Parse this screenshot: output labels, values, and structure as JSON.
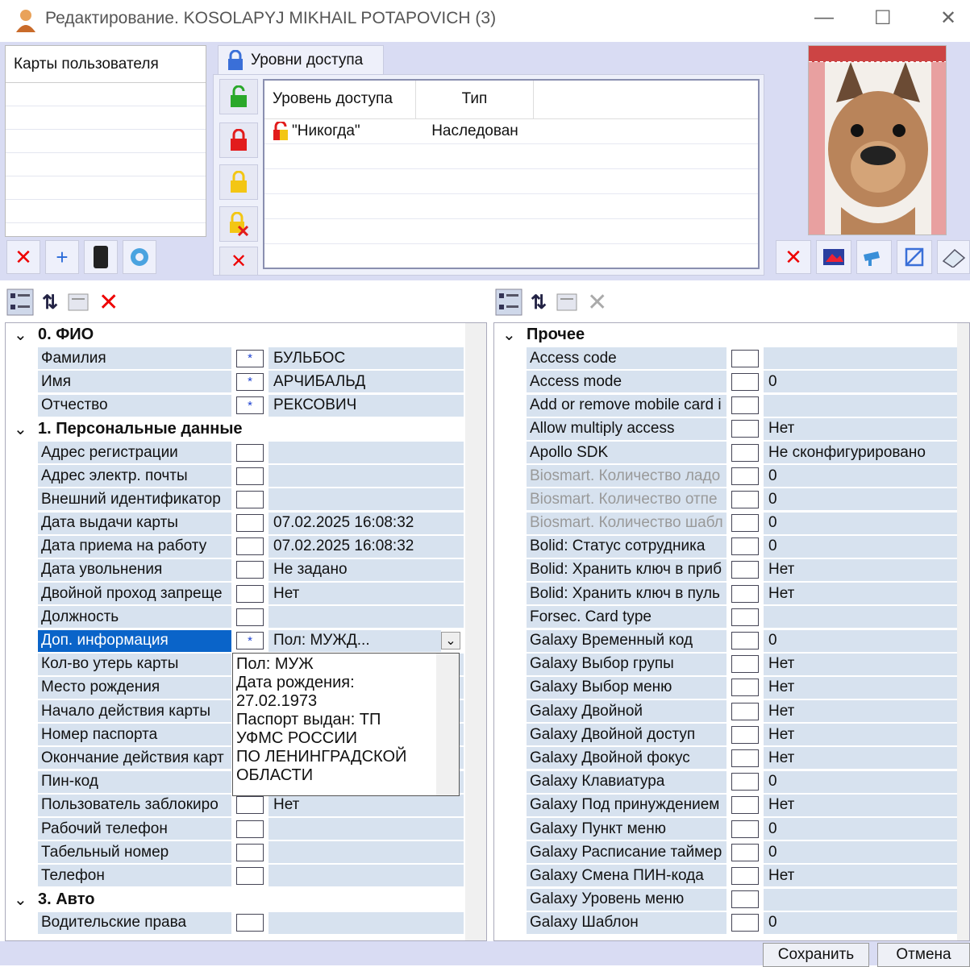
{
  "window": {
    "title": "Редактирование. KOSOLAPYJ MIKHAIL POTAPOVICH (3)",
    "minimize": "—",
    "maximize": "☐",
    "close": "✕"
  },
  "cards": {
    "header": "Карты пользователя"
  },
  "access": {
    "tab_label": "Уровни доступа",
    "col_level": "Уровень доступа",
    "col_type": "Тип",
    "rows": [
      {
        "level": "\"Никогда\"",
        "type": "Наследован"
      }
    ]
  },
  "left_grid": {
    "rows": [
      {
        "cat": true,
        "name": "0. ФИО"
      },
      {
        "name": "Фамилия",
        "star": true,
        "value": "БУЛЬБОС"
      },
      {
        "name": "Имя",
        "star": true,
        "value": "АРЧИБАЛЬД"
      },
      {
        "name": "Отчество",
        "star": true,
        "value": "РЕКСОВИЧ"
      },
      {
        "cat": true,
        "name": "1. Персональные данные"
      },
      {
        "name": "Адрес регистрации",
        "value": ""
      },
      {
        "name": "Адрес электр. почты",
        "value": ""
      },
      {
        "name": "Внешний идентификатор",
        "value": ""
      },
      {
        "name": "Дата выдачи карты",
        "value": "07.02.2025 16:08:32"
      },
      {
        "name": "Дата приема на работу",
        "value": "07.02.2025 16:08:32"
      },
      {
        "name": "Дата увольнения",
        "value": "Не задано"
      },
      {
        "name": "Двойной проход запреще",
        "value": "Нет"
      },
      {
        "name": "Должность",
        "value": ""
      },
      {
        "name": "Доп. информация",
        "star": true,
        "value": "Пол: МУЖД...",
        "selected": true
      },
      {
        "name": "Кол-во утерь карты",
        "value": ""
      },
      {
        "name": "Место рождения",
        "value": ""
      },
      {
        "name": "Начало действия карты",
        "value": ""
      },
      {
        "name": "Номер паспорта",
        "value": ""
      },
      {
        "name": "Окончание действия карт",
        "value": ""
      },
      {
        "name": "Пин-код",
        "value": ""
      },
      {
        "name": "Пользователь заблокиро",
        "value": "Нет"
      },
      {
        "name": "Рабочий телефон",
        "value": ""
      },
      {
        "name": "Табельный номер",
        "value": ""
      },
      {
        "name": "Телефон",
        "value": ""
      },
      {
        "cat": true,
        "name": "3. Авто"
      },
      {
        "name": "Водительские права",
        "value": ""
      }
    ]
  },
  "dropdown": {
    "lines": [
      "Пол: МУЖ",
      "Дата рождения:",
      "27.02.1973",
      "Паспорт выдан: ТП",
      "УФМС РОССИИ",
      "ПО ЛЕНИНГРАДСКОЙ",
      "ОБЛАСТИ"
    ]
  },
  "right_grid": {
    "rows": [
      {
        "cat": true,
        "name": "Прочее"
      },
      {
        "name": "Access code",
        "value": ""
      },
      {
        "name": "Access mode",
        "value": "0"
      },
      {
        "name": "Add or remove mobile card i",
        "value": ""
      },
      {
        "name": "Allow multiply access",
        "value": "Нет"
      },
      {
        "name": "Apollo SDK",
        "value": "Не сконфигурировано"
      },
      {
        "name": "Biosmart. Количество ладо",
        "value": "0",
        "dim": true
      },
      {
        "name": "Biosmart. Количество отпе",
        "value": "0",
        "dim": true
      },
      {
        "name": "Biosmart. Количество шабл",
        "value": "0",
        "dim": true
      },
      {
        "name": "Bolid: Статус сотрудника",
        "value": "0"
      },
      {
        "name": "Bolid: Хранить ключ в приб",
        "value": "Нет"
      },
      {
        "name": "Bolid: Хранить ключ в пуль",
        "value": "Нет"
      },
      {
        "name": "Forsec. Card type",
        "value": ""
      },
      {
        "name": "Galaxy Временный код",
        "value": "0"
      },
      {
        "name": "Galaxy Выбор групы",
        "value": "Нет"
      },
      {
        "name": "Galaxy Выбор меню",
        "value": "Нет"
      },
      {
        "name": "Galaxy Двойной",
        "value": "Нет"
      },
      {
        "name": "Galaxy Двойной доступ",
        "value": "Нет"
      },
      {
        "name": "Galaxy Двойной фокус",
        "value": "Нет"
      },
      {
        "name": "Galaxy Клавиатура",
        "value": "0"
      },
      {
        "name": "Galaxy Под принуждением",
        "value": "Нет"
      },
      {
        "name": "Galaxy Пункт меню",
        "value": "0"
      },
      {
        "name": "Galaxy Расписание таймер",
        "value": "0"
      },
      {
        "name": "Galaxy Смена ПИН-кода",
        "value": "Нет"
      },
      {
        "name": "Galaxy Уровень меню",
        "value": ""
      },
      {
        "name": "Galaxy Шаблон",
        "value": "0"
      }
    ]
  },
  "buttons": {
    "save": "Сохранить",
    "cancel": "Отмена"
  },
  "colors": {
    "accent": "#0a64c9",
    "row_bg": "#d7e2ef",
    "panel_bg": "#d9dcf3"
  }
}
